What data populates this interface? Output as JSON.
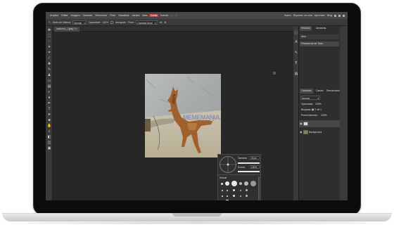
{
  "menubar": {
    "items": [
      "Arquivo",
      "Editar",
      "Imagem",
      "Camada",
      "Selecionar",
      "Filtro",
      "Visualizar",
      "Janela",
      "Mais",
      "Conta",
      "Grande"
    ],
    "highlighted_index": 9,
    "right_items": [
      "Sobre",
      "Reportar um erro",
      "Aprender",
      "Blog"
    ]
  },
  "options": {
    "brush_label": "Modo de Mistura",
    "mode": "Normal",
    "opacity_label": "Opacidade",
    "opacity": "100%",
    "flow_label": "Vaz.",
    "flow": "100%",
    "smooth_label": "Fluxo",
    "airbrush_label": "Aerógrafo",
    "sample_label": "Amostra",
    "sample": "Camada Atual",
    "all_label": "All"
  },
  "document": {
    "tab_label": "cachorro_1.jpeg *"
  },
  "watermark": "MEMEMANIA.COM",
  "brush_popup": {
    "size_label": "Tamanho",
    "size_value": "15 px",
    "hardness_label": "Dureza",
    "hardness_value": "100%",
    "preset_label": "Default"
  },
  "panels": {
    "top_tabs": [
      "Histórico",
      "Amostras"
    ],
    "history_items": [
      "Abrir",
      "Ferramenta de Texto"
    ],
    "layer_tabs": [
      "Camadas",
      "Canais",
      "Demarcadores"
    ],
    "blend_mode": "Normal",
    "opacity_label": "Opacidade:",
    "opacity_value": "100%",
    "lock_label": "Bloquear:",
    "fill_label": "Preenchimento:",
    "fill_value": "100%",
    "layers": [
      {
        "name": ""
      },
      {
        "name": "Background"
      }
    ]
  },
  "colors": {
    "accent": "#d23b3b",
    "screen_bg": "#262626",
    "panel_bg": "#2e2e2e"
  }
}
